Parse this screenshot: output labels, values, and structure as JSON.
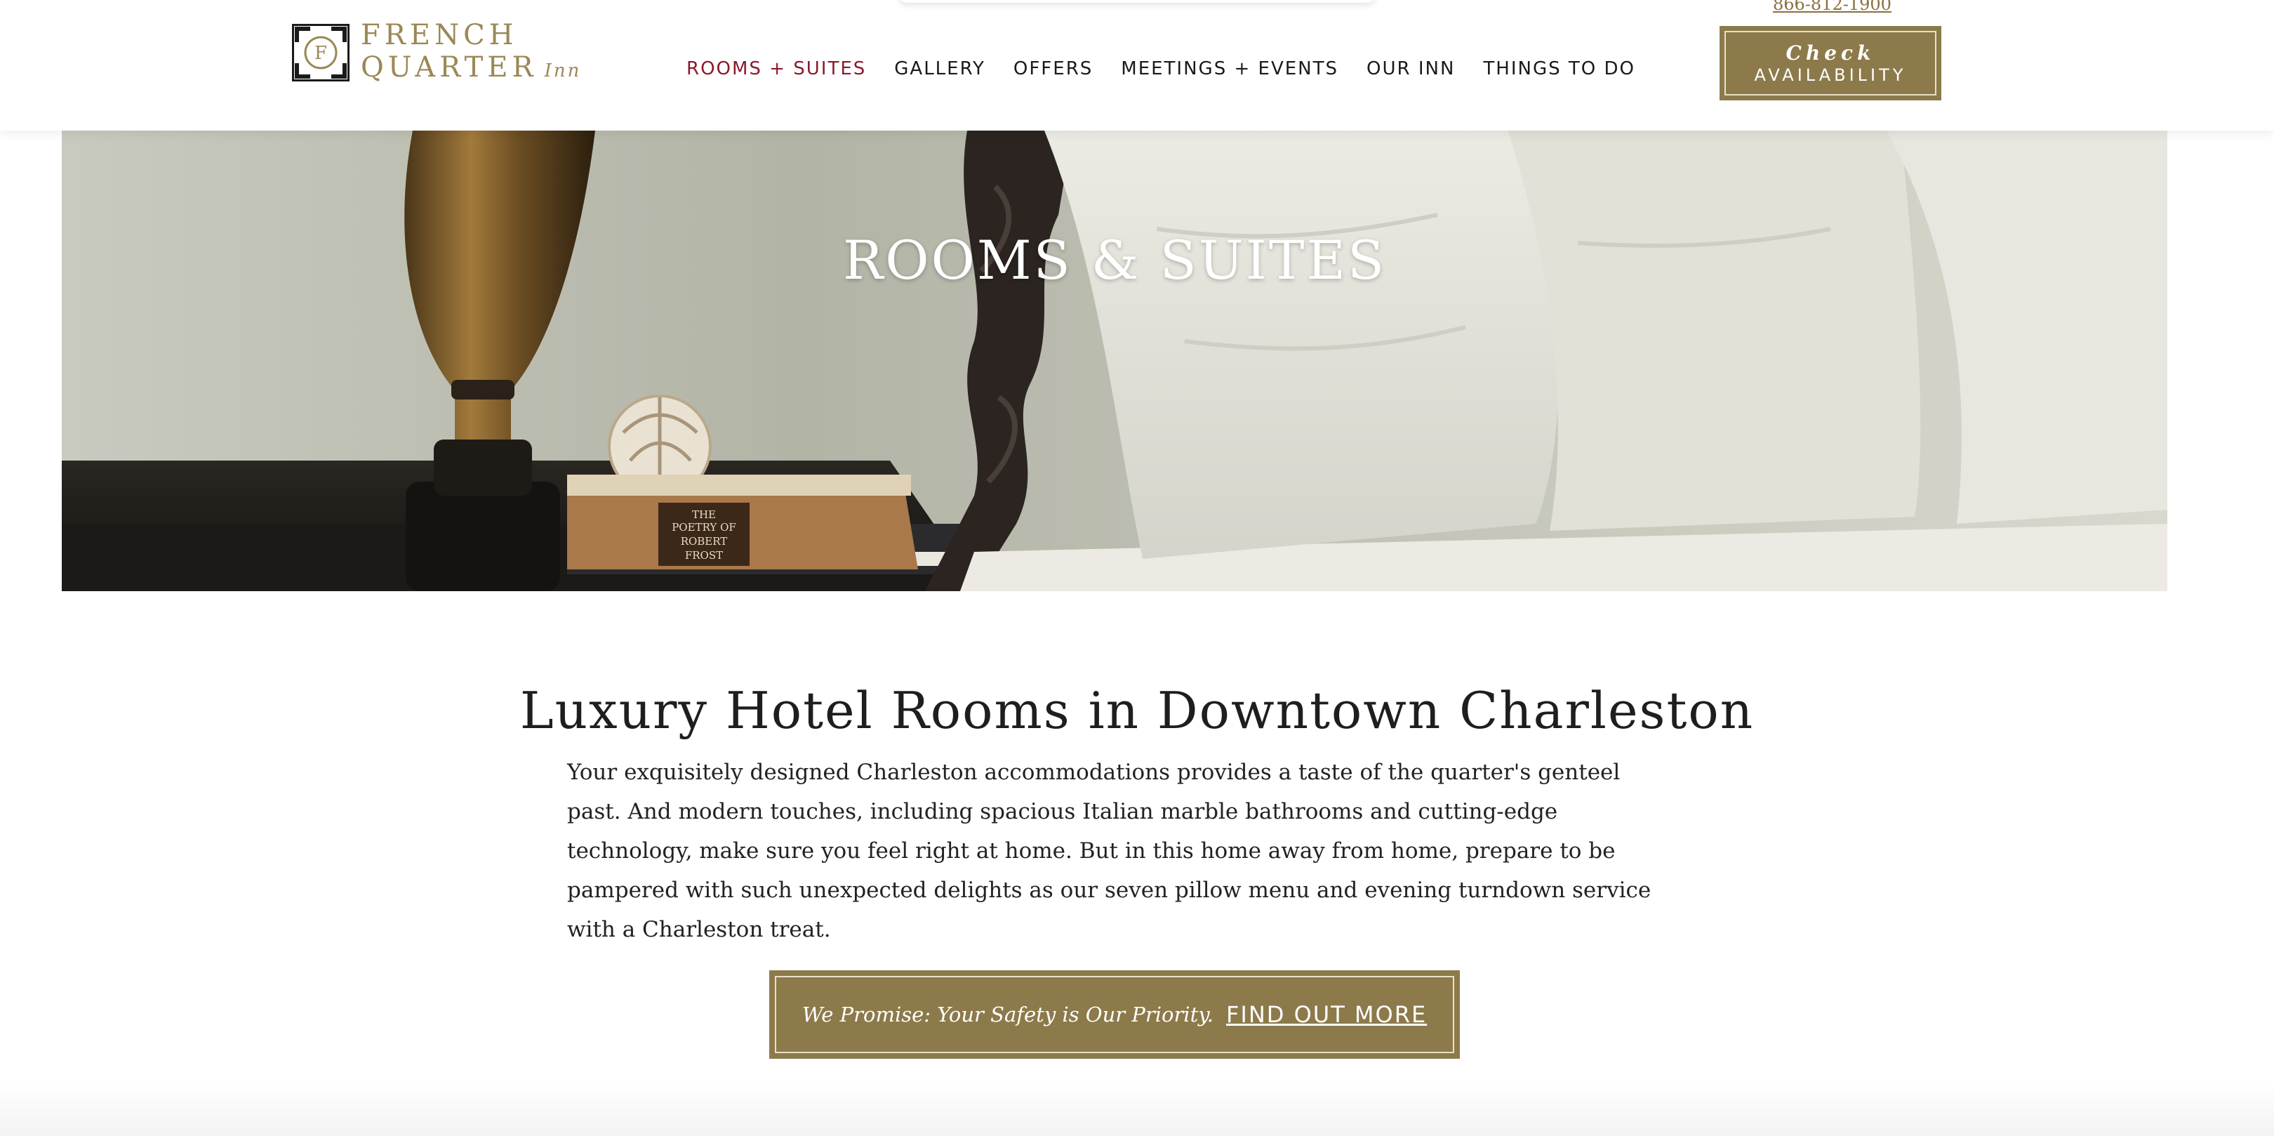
{
  "header": {
    "logo": {
      "line1": "FRENCH",
      "line2": "QUARTER",
      "suffix": "Inn"
    },
    "phone": "866-812-1900",
    "check_availability": {
      "line1": "Check",
      "line2": "AVAILABILITY"
    },
    "nav": [
      {
        "label": "ROOMS + SUITES",
        "active": true
      },
      {
        "label": "GALLERY",
        "active": false
      },
      {
        "label": "OFFERS",
        "active": false
      },
      {
        "label": "MEETINGS + EVENTS",
        "active": false
      },
      {
        "label": "OUR INN",
        "active": false
      },
      {
        "label": "THINGS TO DO",
        "active": false
      }
    ]
  },
  "hero": {
    "title": "ROOMS & SUITES",
    "book_spine": {
      "line1": "THE",
      "line2": "POETRY OF",
      "line3": "ROBERT",
      "line4": "FROST"
    }
  },
  "main": {
    "headline": "Luxury Hotel Rooms in Downtown Charleston",
    "intro": "Your exquisitely designed Charleston accommodations provides a taste of the quarter's genteel past. And modern touches, including spacious Italian marble bathrooms and cutting-edge technology, make sure you feel right at home. But in this home away from home, prepare to be pampered with such unexpected delights as our seven pillow menu and evening turndown service with a Charleston treat.",
    "promise": {
      "text": "We Promise: Your Safety is Our Priority.",
      "link": "FIND OUT MORE"
    }
  },
  "colors": {
    "brand_gold": "#8c7a4b",
    "logo_gold": "#9a8855",
    "nav_active": "#8b1a2b",
    "text_dark": "#1e1e1e"
  }
}
